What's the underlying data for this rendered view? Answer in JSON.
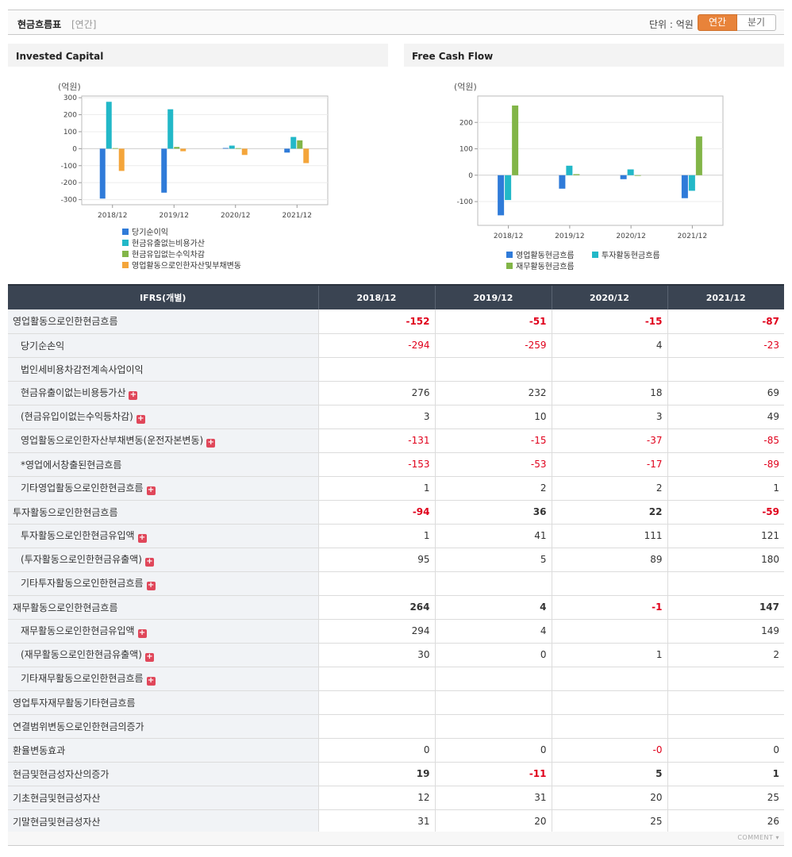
{
  "header": {
    "title": "현금흐름표",
    "period": "[연간]",
    "unit": "단위 : 억원",
    "tab_annual": "연간",
    "tab_quarter": "분기"
  },
  "charts": [
    {
      "title": "Invested Capital",
      "unit_label": "(억원)",
      "type": "bar",
      "categories": [
        "2018/12",
        "2019/12",
        "2020/12",
        "2021/12"
      ],
      "ylim": [
        -330,
        310
      ],
      "yticks": [
        300,
        200,
        100,
        0,
        -100,
        -200,
        -300
      ],
      "series": [
        {
          "name": "당기순이익",
          "color": "#2f7bd9",
          "values": [
            -294,
            -259,
            4,
            -23
          ]
        },
        {
          "name": "현금유출없는비용가산",
          "color": "#22b8c8",
          "values": [
            276,
            232,
            18,
            69
          ]
        },
        {
          "name": "현금유입없는수익차감",
          "color": "#82b548",
          "values": [
            3,
            10,
            3,
            49
          ]
        },
        {
          "name": "영업활동으로인한자산및부채변동",
          "color": "#f4a53a",
          "values": [
            -131,
            -15,
            -37,
            -85
          ]
        }
      ]
    },
    {
      "title": "Free Cash Flow",
      "unit_label": "(억원)",
      "type": "bar",
      "categories": [
        "2018/12",
        "2019/12",
        "2020/12",
        "2021/12"
      ],
      "ylim": [
        -190,
        300
      ],
      "yticks": [
        200,
        100,
        0,
        -100
      ],
      "series": [
        {
          "name": "영업활동현금흐름",
          "color": "#2f7bd9",
          "values": [
            -152,
            -51,
            -15,
            -87
          ]
        },
        {
          "name": "투자활동현금흐름",
          "color": "#22b8c8",
          "values": [
            -94,
            36,
            22,
            -59
          ]
        },
        {
          "name": "재무활동현금흐름",
          "color": "#82b548",
          "values": [
            264,
            4,
            -1,
            147
          ]
        }
      ]
    }
  ],
  "table": {
    "header": [
      "IFRS(개별)",
      "2018/12",
      "2019/12",
      "2020/12",
      "2021/12"
    ],
    "rows": [
      {
        "label": "영업활동으로인한현금흐름",
        "level": 0,
        "bold": true,
        "plus": false,
        "values": [
          "-152",
          "-51",
          "-15",
          "-87"
        ]
      },
      {
        "label": "당기순손익",
        "level": 1,
        "bold": false,
        "plus": false,
        "values": [
          "-294",
          "-259",
          "4",
          "-23"
        ]
      },
      {
        "label": "법인세비용차감전계속사업이익",
        "level": 1,
        "bold": false,
        "plus": false,
        "values": [
          "",
          "",
          "",
          ""
        ]
      },
      {
        "label": "현금유출이없는비용등가산",
        "level": 1,
        "bold": false,
        "plus": true,
        "values": [
          "276",
          "232",
          "18",
          "69"
        ]
      },
      {
        "label": "(현금유입이없는수익등차감)",
        "level": 1,
        "bold": false,
        "plus": true,
        "values": [
          "3",
          "10",
          "3",
          "49"
        ]
      },
      {
        "label": "영업활동으로인한자산부채변동(운전자본변동)",
        "level": 1,
        "bold": false,
        "plus": true,
        "values": [
          "-131",
          "-15",
          "-37",
          "-85"
        ]
      },
      {
        "label": "*영업에서창출된현금흐름",
        "level": 1,
        "bold": false,
        "plus": false,
        "values": [
          "-153",
          "-53",
          "-17",
          "-89"
        ]
      },
      {
        "label": "기타영업활동으로인한현금흐름",
        "level": 1,
        "bold": false,
        "plus": true,
        "values": [
          "1",
          "2",
          "2",
          "1"
        ]
      },
      {
        "label": "투자활동으로인한현금흐름",
        "level": 0,
        "bold": true,
        "plus": false,
        "values": [
          "-94",
          "36",
          "22",
          "-59"
        ]
      },
      {
        "label": "투자활동으로인한현금유입액",
        "level": 1,
        "bold": false,
        "plus": true,
        "values": [
          "1",
          "41",
          "111",
          "121"
        ]
      },
      {
        "label": "(투자활동으로인한현금유출액)",
        "level": 1,
        "bold": false,
        "plus": true,
        "values": [
          "95",
          "5",
          "89",
          "180"
        ]
      },
      {
        "label": "기타투자활동으로인한현금흐름",
        "level": 1,
        "bold": false,
        "plus": true,
        "values": [
          "",
          "",
          "",
          ""
        ]
      },
      {
        "label": "재무활동으로인한현금흐름",
        "level": 0,
        "bold": true,
        "plus": false,
        "values": [
          "264",
          "4",
          "-1",
          "147"
        ]
      },
      {
        "label": "재무활동으로인한현금유입액",
        "level": 1,
        "bold": false,
        "plus": true,
        "values": [
          "294",
          "4",
          "",
          "149"
        ]
      },
      {
        "label": "(재무활동으로인한현금유출액)",
        "level": 1,
        "bold": false,
        "plus": true,
        "values": [
          "30",
          "0",
          "1",
          "2"
        ]
      },
      {
        "label": "기타재무활동으로인한현금흐름",
        "level": 1,
        "bold": false,
        "plus": true,
        "values": [
          "",
          "",
          "",
          ""
        ]
      },
      {
        "label": "영업투자재무활동기타현금흐름",
        "level": 0,
        "bold": false,
        "plus": false,
        "values": [
          "",
          "",
          "",
          ""
        ]
      },
      {
        "label": "연결범위변동으로인한현금의증가",
        "level": 0,
        "bold": false,
        "plus": false,
        "values": [
          "",
          "",
          "",
          ""
        ]
      },
      {
        "label": "환율변동효과",
        "level": 0,
        "bold": false,
        "plus": false,
        "values": [
          "0",
          "0",
          "-0",
          "0"
        ]
      },
      {
        "label": "현금및현금성자산의증가",
        "level": 0,
        "bold": true,
        "plus": false,
        "values": [
          "19",
          "-11",
          "5",
          "1"
        ]
      },
      {
        "label": "기초현금및현금성자산",
        "level": 0,
        "bold": false,
        "plus": false,
        "values": [
          "12",
          "31",
          "20",
          "25"
        ]
      },
      {
        "label": "기말현금및현금성자산",
        "level": 0,
        "bold": false,
        "plus": false,
        "values": [
          "31",
          "20",
          "25",
          "26"
        ]
      }
    ]
  },
  "footer": {
    "comment": "COMMENT"
  }
}
